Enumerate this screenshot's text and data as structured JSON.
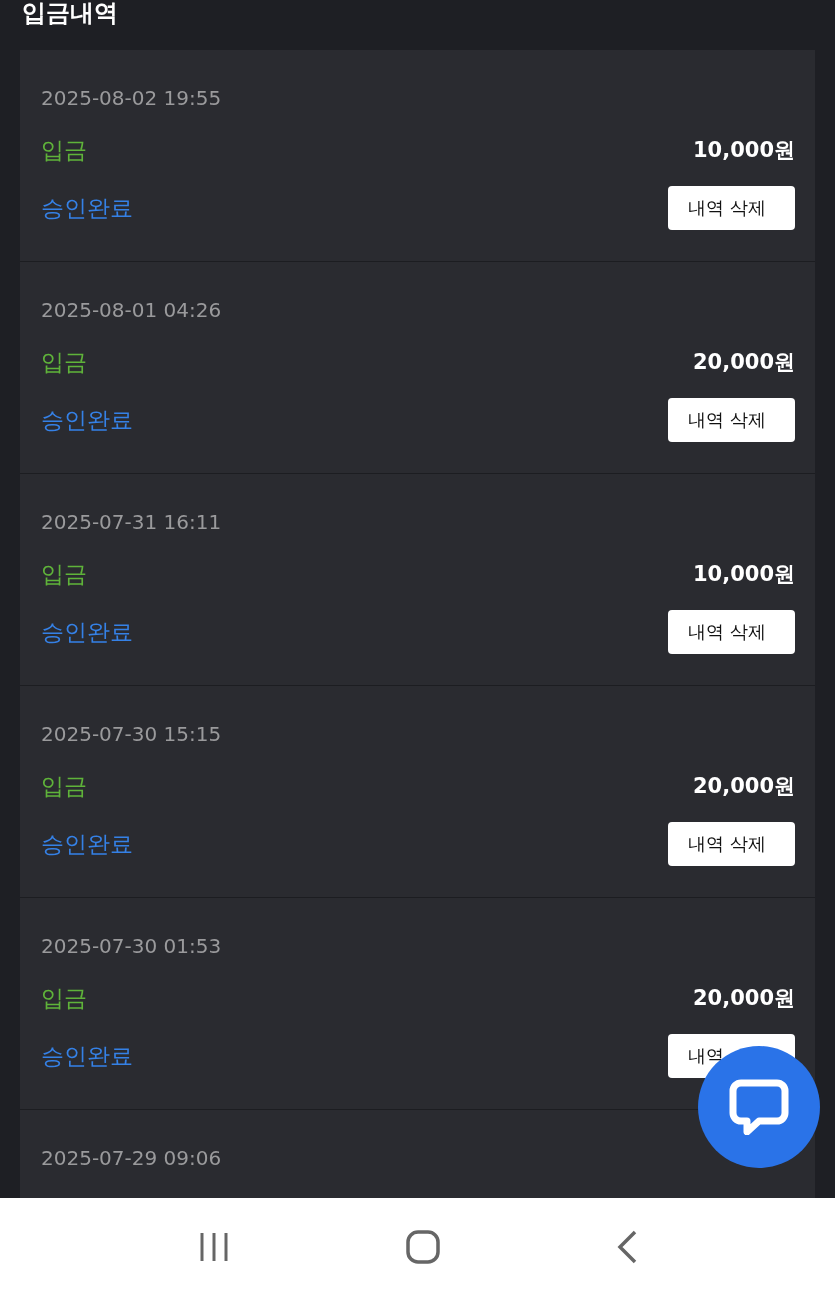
{
  "title": "입금내역",
  "records": [
    {
      "date": "2025-08-02 19:55",
      "type": "입금",
      "amount": "10,000원",
      "status": "승인완료",
      "button": "내역 삭제"
    },
    {
      "date": "2025-08-01 04:26",
      "type": "입금",
      "amount": "20,000원",
      "status": "승인완료",
      "button": "내역 삭제"
    },
    {
      "date": "2025-07-31 16:11",
      "type": "입금",
      "amount": "10,000원",
      "status": "승인완료",
      "button": "내역 삭제"
    },
    {
      "date": "2025-07-30 15:15",
      "type": "입금",
      "amount": "20,000원",
      "status": "승인완료",
      "button": "내역 삭제"
    },
    {
      "date": "2025-07-30 01:53",
      "type": "입금",
      "amount": "20,000원",
      "status": "승인완료",
      "button": "내역"
    },
    {
      "date": "2025-07-29 09:06"
    }
  ]
}
